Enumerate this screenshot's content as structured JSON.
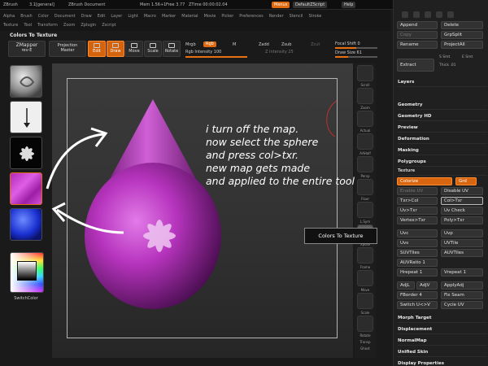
{
  "titlebar": {
    "app": "ZBrush",
    "version": "3.1[general]",
    "document": "ZBrush Document",
    "mem": "Mem 1.56+1",
    "free": "Free 3.77",
    "ztime": "ZTime 00:00:02.04",
    "menus_btn": "Menus",
    "script_btn": "DefaultZScript",
    "help_btn": "Help"
  },
  "menus": {
    "row1": [
      "Alpha",
      "Brush",
      "Color",
      "Document",
      "Draw",
      "Edit",
      "Layer",
      "Light",
      "Macro",
      "Marker",
      "Material",
      "Movie",
      "Picker",
      "Preferences",
      "Render",
      "Stencil",
      "Stroke"
    ],
    "row2": [
      "Texture",
      "Tool",
      "Transform",
      "Zoom",
      "Zplugin",
      "Zscript"
    ]
  },
  "breadcrumb": "Colors To Texture",
  "toolbar": {
    "zmapper_label": "ZMapper",
    "zmapper_rev": "rev-E",
    "projection_label": "Projection",
    "projection_master": "Master",
    "edit": "Edit",
    "draw": "Draw",
    "move": "Move",
    "scale": "Scale",
    "rotate": "Rotate",
    "mrgb": "Mrgb",
    "rgb": "Rgb",
    "m": "M",
    "rgb_intensity_label": "Rgb Intensity",
    "rgb_intensity": "100",
    "zadd": "Zadd",
    "zsub": "Zsub",
    "zcut": "Zcut",
    "z_intensity_label": "Z Intensity",
    "z_intensity": "25",
    "focal_shift_label": "Focal Shift",
    "focal_shift": "0",
    "draw_size_label": "Draw Size",
    "draw_size": "61",
    "rgb_intensity_fill": 1.0,
    "focal_shift_fill": 0.5,
    "draw_size_fill": 0.3
  },
  "leftshelf": {
    "switchcolor": "SwitchColor"
  },
  "annotation": {
    "lines": [
      "i turn off the map.",
      "now select the sphere",
      "and press col>txr.",
      "new map gets made",
      "and applied to the entire tool"
    ]
  },
  "tooltip": "Colors To Texture",
  "rightshelf": {
    "items": [
      "Scroll",
      "Zoom",
      "Actual",
      "AAHalf",
      "Persp",
      "Floor",
      "L.Sym",
      "Xpose",
      "Frame",
      "Move",
      "Scale",
      "Rotate",
      "Transp",
      "Ghost"
    ]
  },
  "palette": {
    "append": "Append",
    "delete": "Delete",
    "copy": "Copy",
    "grpsplit": "GrpSplit",
    "rename": "Rename",
    "projectall": "ProjectAll",
    "extract": "Extract",
    "s_smt": "S Smt",
    "e_smt": "E Smt",
    "thick_label": "Thick",
    "thick_value": ".01",
    "sections": [
      "Layers",
      "Geometry",
      "Geometry HD",
      "Preview",
      "Deformation",
      "Masking",
      "Polygroups"
    ],
    "texture_header": "Texture",
    "colorize": "Colorize",
    "grd": "Grd",
    "enable_uv": "Enable UV",
    "disable_uv": "Disable UV",
    "txr_col": "Txr>Col",
    "col_txr": "Col>Txr",
    "uv_txr": "Uv>Txr",
    "uv_check": "Uv Check",
    "vertex_txr": "Vertex>Txr",
    "poly_txr": "Poly>Txr",
    "uvc": "Uvc",
    "uvp": "Uvp",
    "uvs": "Uvs",
    "uvtile": "UVTile",
    "suvtiles": "SUVTiles",
    "auvtiles": "AUVTiles",
    "auvratio_label": "AUVRatio",
    "auvratio": "1",
    "hrepeat_label": "Hrepeat",
    "hrepeat": "1",
    "vrepeat_label": "Vrepeat",
    "vrepeat": "1",
    "adjl": "AdjL",
    "adju": "AdjV",
    "applyadj": "ApplyAdj",
    "fborder_label": "FBorder",
    "fborder": "4",
    "fix_seam": "Fix Seam",
    "switch_uv": "Switch U<>V",
    "cycle_uv": "Cycle UV",
    "bottom_sections": [
      "Morph Target",
      "Displacement",
      "NormalMap",
      "Unified Skin",
      "Display Properties"
    ]
  },
  "colors": {
    "accent": "#e06a10",
    "texture_magenta": "#c236c9",
    "annotation": "#ffffff"
  }
}
